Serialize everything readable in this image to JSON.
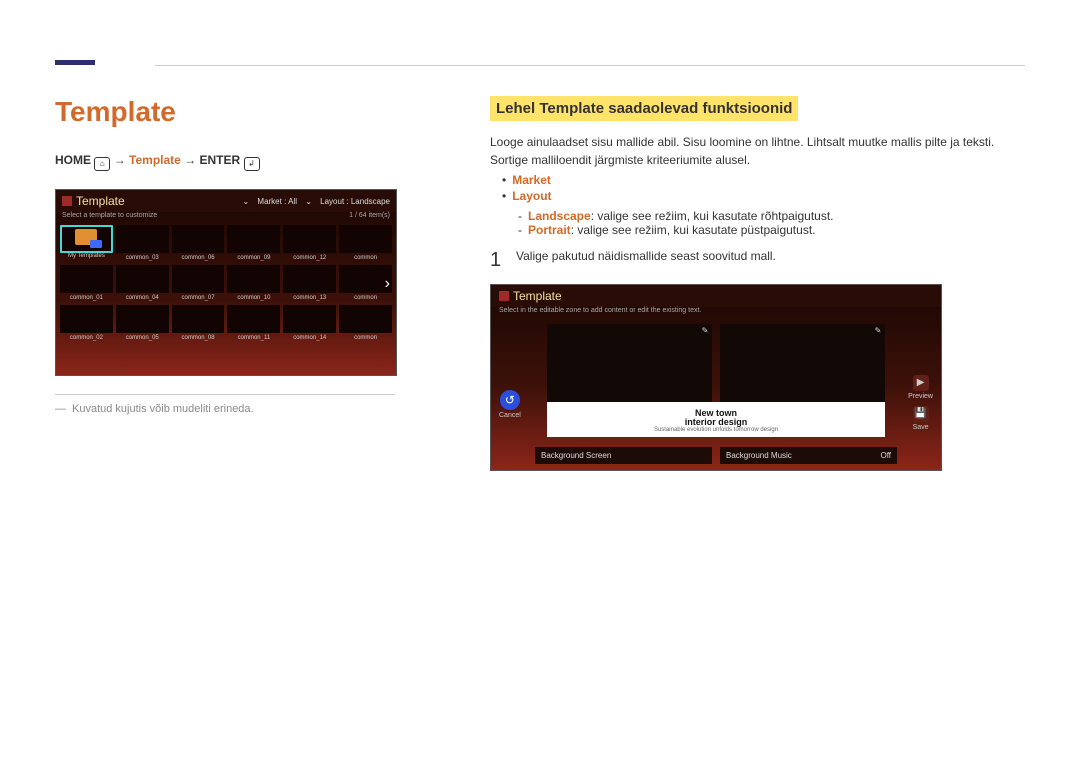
{
  "header": {
    "title": "Template",
    "breadcrumb_home": "HOME",
    "breadcrumb_arrow1": " → ",
    "breadcrumb_template": "Template",
    "breadcrumb_arrow2": " → ",
    "breadcrumb_enter": "ENTER"
  },
  "left_screenshot": {
    "window_title": "Template",
    "subtitle_left": "Select a template to customize",
    "market_label": "Market : All",
    "layout_label": "Layout : Landscape",
    "count": "1 / 64 item(s)",
    "my_templates": "My Templates",
    "cells": {
      "r1": [
        "common_03",
        "common_06",
        "common_09",
        "common_12",
        "common"
      ],
      "r2": [
        "common_01",
        "common_04",
        "common_07",
        "common_10",
        "common_13",
        "common"
      ],
      "r3": [
        "common_02",
        "common_05",
        "common_08",
        "common_11",
        "common_14",
        "common"
      ]
    }
  },
  "footnote": "Kuvatud kujutis võib mudeliti erineda.",
  "right": {
    "h2": "Lehel Template saadaolevad funktsioonid",
    "p1": "Looge ainulaadset sisu mallide abil. Sisu loomine on lihtne. Lihtsalt muutke mallis pilte ja teksti.",
    "p2": "Sortige malliloendit järgmiste kriteeriumite alusel.",
    "bullet_market": "Market",
    "bullet_layout": "Layout",
    "sub_landscape_k": "Landscape",
    "sub_landscape_v": ": valige see režiim, kui kasutate rõhtpaigutust.",
    "sub_portrait_k": "Portrait",
    "sub_portrait_v": ": valige see režiim, kui kasutate püstpaigutust.",
    "step1_num": "1",
    "step1_text": "Valige pakutud näidismallide seast soovitud mall."
  },
  "right_screenshot": {
    "window_title": "Template",
    "subtitle": "Select in the editable zone to add content or edit the existing text.",
    "cancel": "Cancel",
    "preview": "Preview",
    "save": "Save",
    "caption_l1": "New  town",
    "caption_l2": "interior  design",
    "caption_sub": "Sustainable evolution unfolds tomorrow design",
    "bg_screen": "Background Screen",
    "bg_music": "Background Music",
    "bg_music_val": "Off"
  }
}
